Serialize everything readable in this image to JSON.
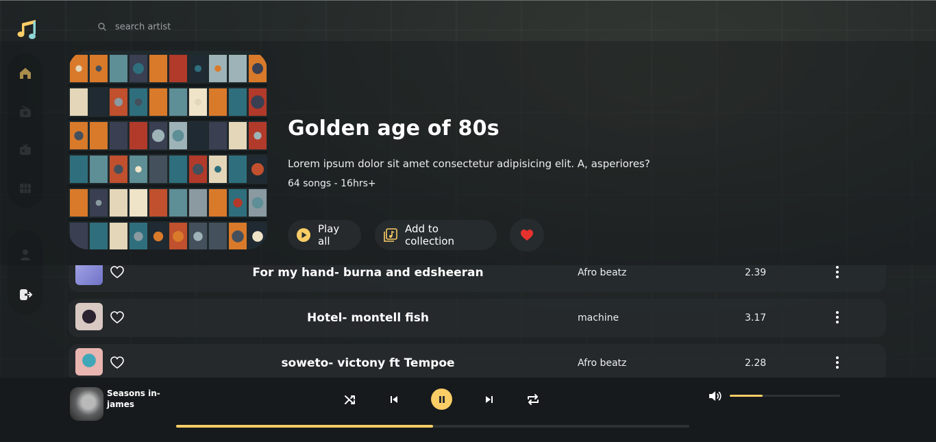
{
  "app": {
    "accent": "#facd66",
    "logo_icon": "music-notes-icon"
  },
  "search": {
    "placeholder": "search artist",
    "icon": "search-icon"
  },
  "sidebar": {
    "top_items": [
      {
        "icon": "home-icon",
        "active": true
      },
      {
        "icon": "radio-icon",
        "active": false
      },
      {
        "icon": "video-icon",
        "active": false
      },
      {
        "icon": "grid-icon",
        "active": false
      }
    ],
    "bottom_items": [
      {
        "icon": "profile-icon"
      },
      {
        "icon": "logout-icon"
      }
    ]
  },
  "playlist": {
    "title": "Golden age of 80s",
    "description": "Lorem ipsum dolor sit amet consectetur adipisicing elit. A, asperiores?",
    "meta": "64 songs - 16hrs+",
    "actions": {
      "play_all": "Play all",
      "add_to_collection": "Add to collection",
      "like_icon": "heart-icon"
    }
  },
  "tracks": [
    {
      "title": "For my hand- burna and edsheeran",
      "genre": "Afro beatz",
      "duration": "2.39"
    },
    {
      "title": "Hotel- montell fish",
      "genre": "machine",
      "duration": "3.17"
    },
    {
      "title": "soweto- victony ft Tempoe",
      "genre": "Afro beatz",
      "duration": "2.28"
    }
  ],
  "player": {
    "now_playing": "Seasons in- james",
    "progress": 0.5,
    "volume": 0.3,
    "controls": [
      "shuffle-icon",
      "previous-icon",
      "pause-icon",
      "next-icon",
      "repeat-icon"
    ]
  }
}
